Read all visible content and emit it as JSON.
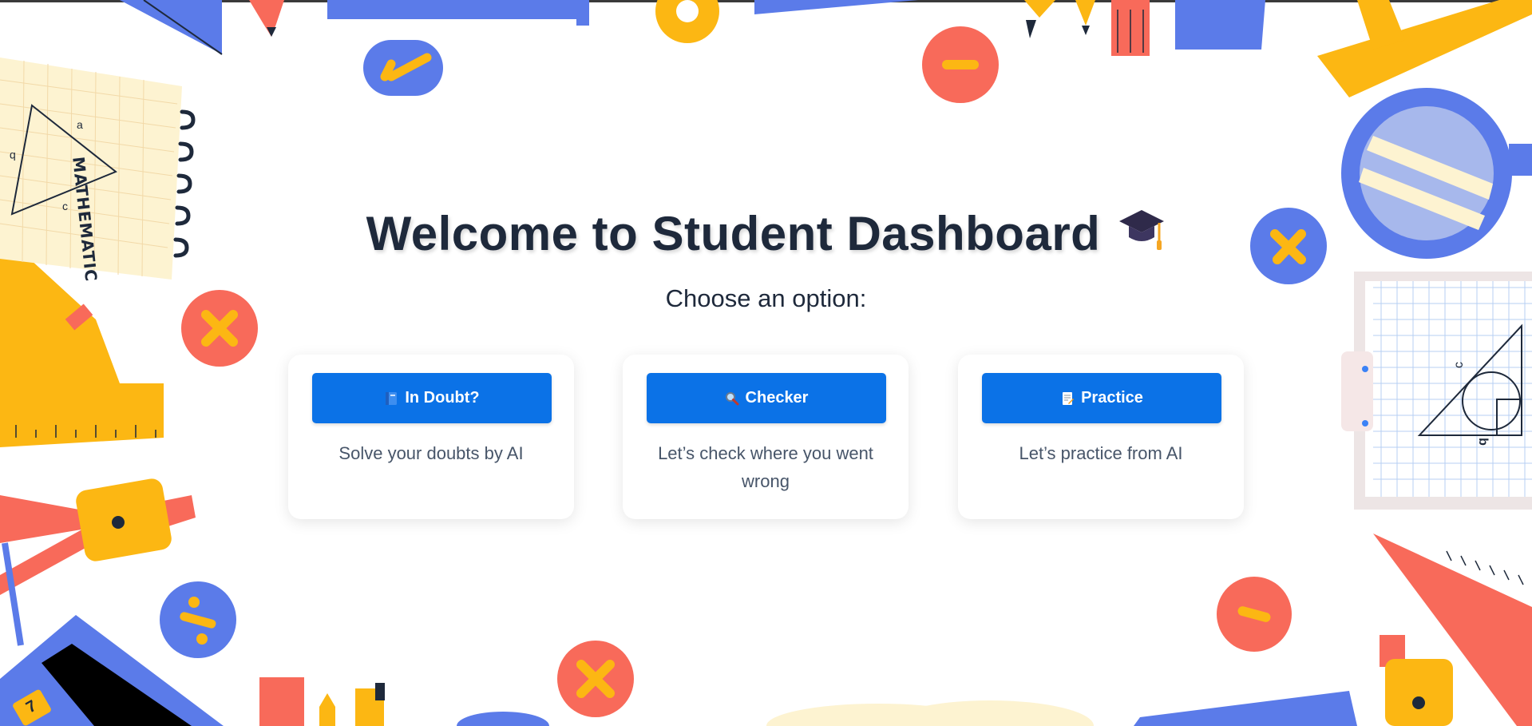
{
  "page": {
    "title": "Welcome to Student Dashboard",
    "title_icon": "graduation-cap-icon",
    "subtitle": "Choose an option:"
  },
  "options": [
    {
      "label": "In Doubt?",
      "icon": "book-icon",
      "description": "Solve your doubts by AI"
    },
    {
      "label": "Checker",
      "icon": "magnifier-icon",
      "description": "Let’s check where you went wrong"
    },
    {
      "label": "Practice",
      "icon": "memo-icon",
      "description": "Let’s practice from AI"
    }
  ],
  "background": {
    "notebook_label": "MATHEMATIC",
    "triangle_labels": [
      "a",
      "b",
      "c"
    ],
    "calculator_key": "7"
  },
  "colors": {
    "button": "#0b72e7",
    "title": "#1e293b",
    "accent_blue": "#5b7be9",
    "accent_yellow": "#fcb713",
    "accent_red": "#f86a5a",
    "paper": "#fdf3d1"
  }
}
